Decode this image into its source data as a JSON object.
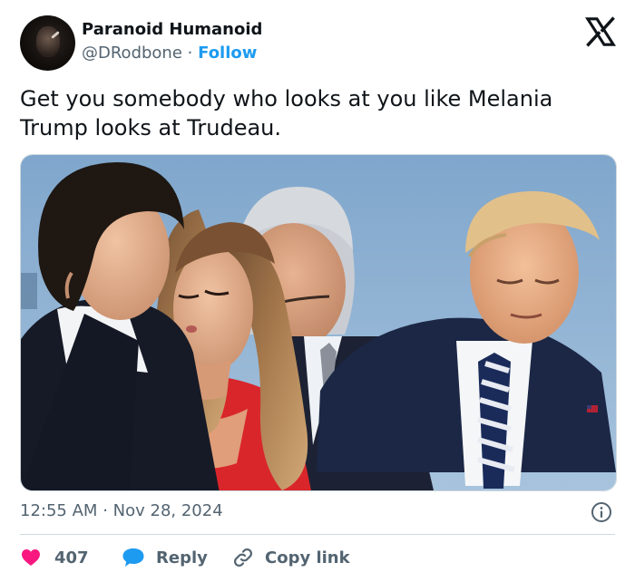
{
  "author": {
    "name": "Paranoid Humanoid",
    "handle": "@DRodbone",
    "separator": "·",
    "follow_label": "Follow"
  },
  "tweet": {
    "text": "Get you somebody who looks at you like Melania Trump looks at Trudeau."
  },
  "meta": {
    "time": "12:55 AM",
    "separator": "·",
    "date": "Nov 28, 2024"
  },
  "actions": {
    "likes": "407",
    "reply_label": "Reply",
    "copy_label": "Copy link"
  },
  "icons": {
    "platform": "x-logo-icon",
    "info": "info-icon",
    "like": "heart-icon",
    "reply": "speech-bubble-icon",
    "copy": "link-icon"
  },
  "colors": {
    "accent": "#1d9bf0",
    "like": "#f91880",
    "text": "#0f1419",
    "muted": "#536471",
    "border": "#cfd9de"
  }
}
